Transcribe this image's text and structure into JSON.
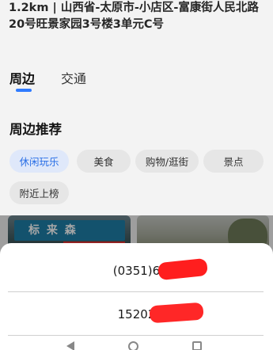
{
  "address": {
    "line1": "1.2km | 山西省-太原市-小店区-富康街人民北路",
    "line2": "20号旺景家园3号楼3单元C号"
  },
  "tabs": [
    {
      "label": "周边",
      "active": true
    },
    {
      "label": "交通",
      "active": false
    }
  ],
  "recommend": {
    "title": "周边推荐",
    "chips": [
      "休闲玩乐",
      "美食",
      "购物/逛街",
      "景点",
      "附近上榜"
    ]
  },
  "thumbnail": {
    "sign_text": "标 来 森"
  },
  "sheet": {
    "phones": [
      "(0351)6",
      "15202"
    ]
  },
  "colors": {
    "accent": "#2f7bff",
    "redaction": "#ff1e1e"
  }
}
